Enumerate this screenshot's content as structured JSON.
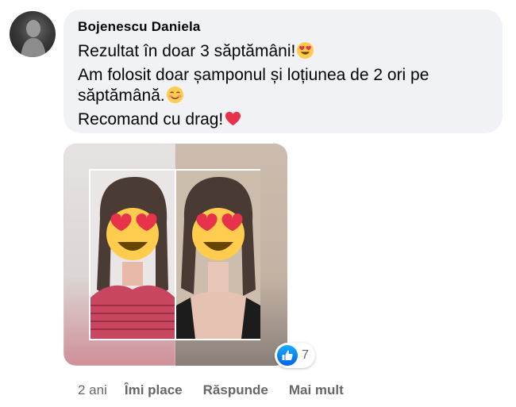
{
  "comment": {
    "author": "Bojenescu Daniela",
    "lines": [
      "Rezultat în doar 3 săptămâni!",
      "Am folosit doar șamponul și loțiunea de 2 ori pe",
      "săptămână.",
      "Recomand cu drag!"
    ],
    "emoji_icons": [
      "heart-eyes-emoji",
      "smiling-blush-emoji",
      "red-heart-emoji"
    ]
  },
  "attachment": {
    "type": "before-after-photo",
    "face_overlay_icon": "heart-eyes-emoji"
  },
  "reactions": {
    "icon": "like-icon",
    "count": "7"
  },
  "actions": {
    "timestamp": "2 ani",
    "like_label": "Îmi place",
    "reply_label": "Răspunde",
    "more_label": "Mai mult"
  },
  "colors": {
    "bubble_bg": "#f0f2f5",
    "secondary_text": "#65676b",
    "like_blue": "#1877f2",
    "heart_red": "#f02849"
  }
}
